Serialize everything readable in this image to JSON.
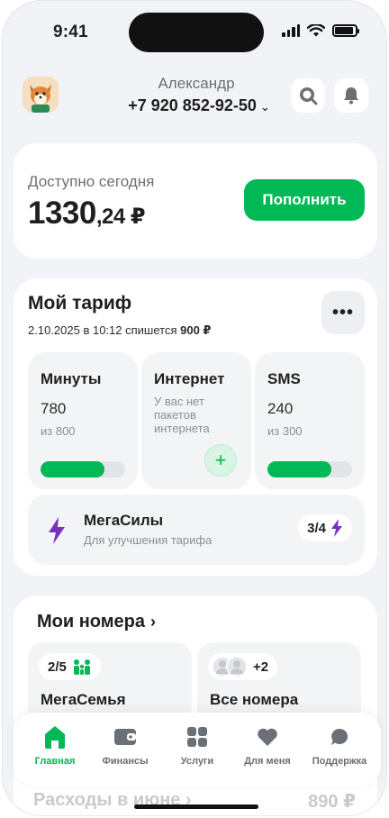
{
  "status_bar": {
    "time": "9:41"
  },
  "header": {
    "user_name": "Александр",
    "phone_number": "+7 920 852-92-50"
  },
  "balance": {
    "label": "Доступно сегодня",
    "amount_int": "1330",
    "amount_frac": ",24 ₽",
    "topup_label": "Пополнить"
  },
  "tariff": {
    "title": "Мой тариф",
    "charge_prefix": "2.10.2025 в 10:12 спишется",
    "charge_amount": "900 ₽",
    "more_label": "•••",
    "minutes": {
      "title": "Минуты",
      "value": "780",
      "of": "из 800",
      "fraction": 0.75
    },
    "internet": {
      "title": "Интернет",
      "note": "У вас нет пакетов интернета",
      "add_label": "+"
    },
    "sms": {
      "title": "SMS",
      "value": "240",
      "of": "из 300",
      "fraction": 0.75
    },
    "megasily": {
      "title": "МегаСилы",
      "subtitle": "Для улучшения тарифа",
      "count": "3/4"
    }
  },
  "numbers": {
    "title": "Мои номера",
    "family": {
      "count": "2/5",
      "title": "МегаСемья"
    },
    "all": {
      "extra": "+2",
      "title": "Все номера"
    }
  },
  "tabs": [
    {
      "label": "Главная"
    },
    {
      "label": "Финансы"
    },
    {
      "label": "Услуги"
    },
    {
      "label": "Для меня"
    },
    {
      "label": "Поддержка"
    }
  ],
  "expenses": {
    "label": "Расходы в июне  ›",
    "value": "890 ₽"
  },
  "colors": {
    "accent": "#00b956",
    "purple": "#7b2fbf",
    "background": "#f2f3f6"
  }
}
